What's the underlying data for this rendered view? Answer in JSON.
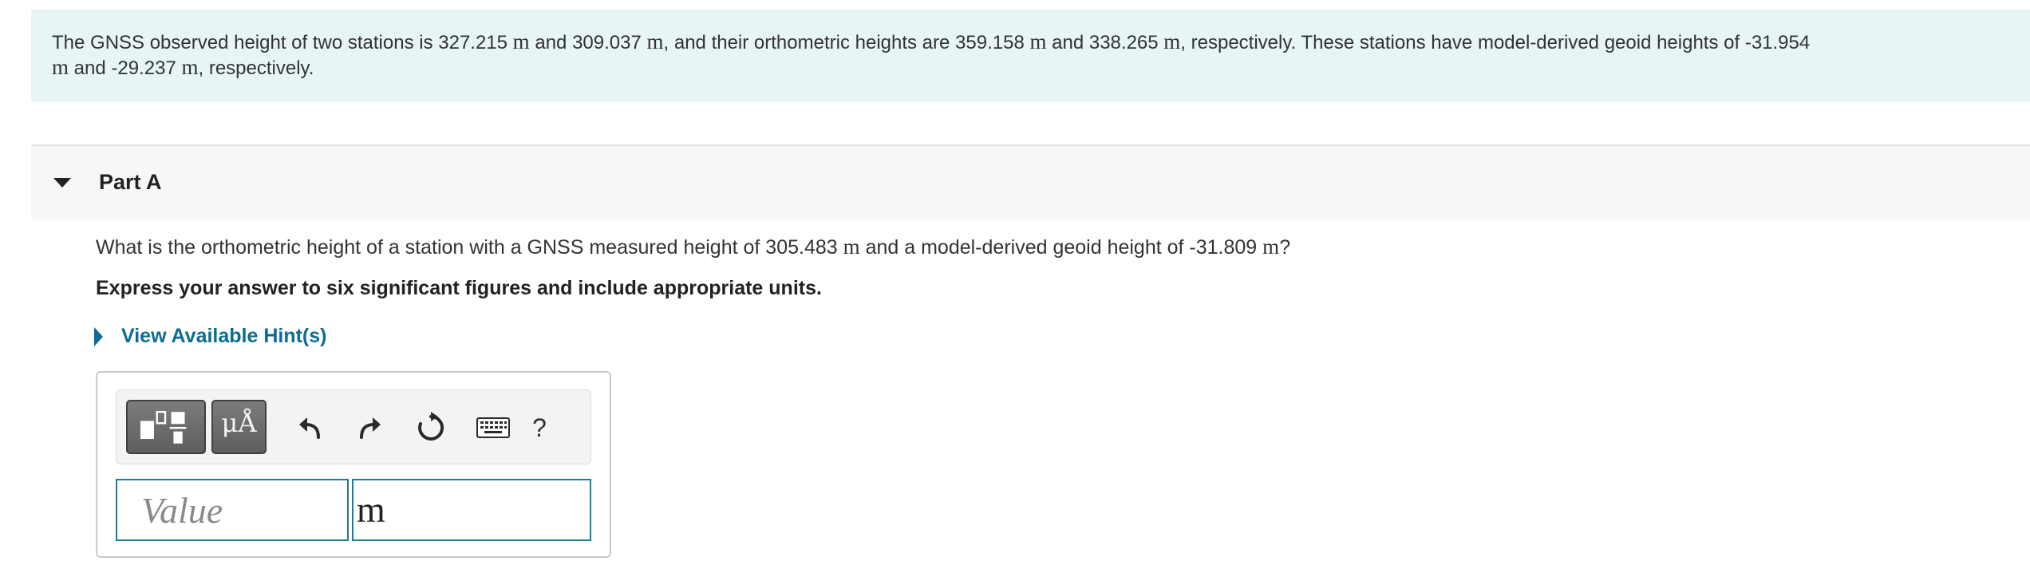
{
  "intro": {
    "t1": "The GNSS observed height of two stations is 327.215 ",
    "u1": "m",
    "t2": " and 309.037 ",
    "u2": "m",
    "t3": ", and their orthometric heights are 359.158 ",
    "u3": "m",
    "t4": " and 338.265 ",
    "u4": "m",
    "t5": ", respectively. These stations have model-derived geoid heights of -31.954",
    "u5": "m",
    "t6": " and -29.237 ",
    "u6": "m",
    "t7": ", respectively."
  },
  "part": {
    "title": "Part A",
    "question": {
      "t1": "What is the orthometric height of a station with a GNSS measured height of 305.483 ",
      "u1": "m",
      "t2": " and a model-derived geoid height of -31.809 ",
      "u2": "m",
      "t3": "?"
    },
    "instruction": "Express your answer to six significant figures and include appropriate units.",
    "hint_label": "View Available Hint(s)"
  },
  "answer": {
    "toolbar": {
      "templates_icon": "templates-icon",
      "units_label": "μÅ",
      "undo_icon": "undo-icon",
      "redo_icon": "redo-icon",
      "reset_icon": "reset-icon",
      "keyboard_icon": "keyboard-icon",
      "help_label": "?"
    },
    "value_placeholder": "Value",
    "value": "",
    "unit": "m"
  },
  "colors": {
    "intro_bg": "#e7f5f5",
    "part_header_bg": "#f7f7f7",
    "link": "#0e6b93",
    "field_border": "#1f7b9a"
  }
}
